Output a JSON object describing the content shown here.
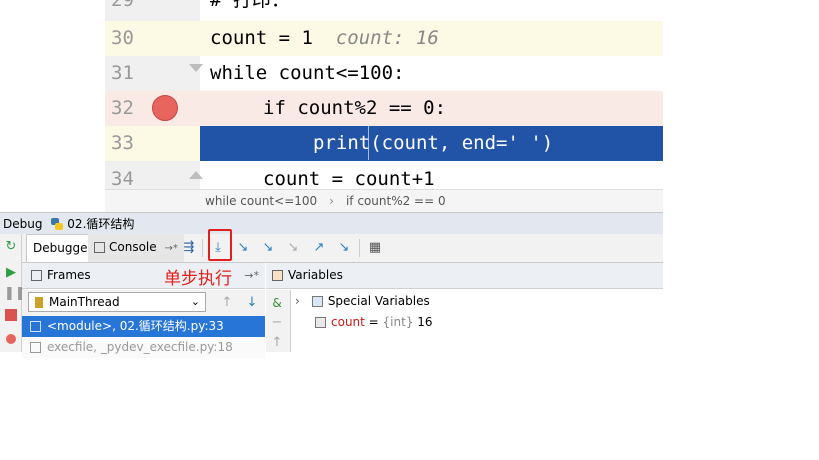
{
  "editor": {
    "lines": [
      {
        "num": "29",
        "code": "# 打印：",
        "partial": true
      },
      {
        "num": "30",
        "code": "count = 1",
        "hint": "count: 16"
      },
      {
        "num": "31",
        "code": "while count<=100:"
      },
      {
        "num": "32",
        "code": "if count%2 == 0:"
      },
      {
        "num": "33",
        "code": "print(count, end=' ')"
      },
      {
        "num": "34",
        "code": "count = count+1"
      }
    ],
    "breadcrumbs": [
      "while count<=100",
      "if count%2 == 0"
    ]
  },
  "debug": {
    "title_prefix": "Debug",
    "config_name": "02.循环结构",
    "tabs": [
      "Debugger",
      "Console"
    ],
    "console_pin": "→*",
    "frames_label": "Frames",
    "frames_pin": "→*",
    "variables_label": "Variables",
    "annotation": "单步执行",
    "thread": "MainThread",
    "frames": [
      {
        "label": "<module>, 02.循环结构.py:33",
        "selected": true
      },
      {
        "label": "execfile, _pydev_execfile.py:18",
        "selected": false
      }
    ],
    "variables": [
      {
        "name": "Special Variables",
        "type": "",
        "value": "",
        "expandable": true
      },
      {
        "name": "count",
        "type": "{int}",
        "value": "16",
        "expandable": false
      }
    ],
    "var_eq": " = "
  },
  "colors": {
    "execution_line": "#2154a7",
    "breakpoint_line": "#faeae6",
    "breakpoint_dot": "#e8655d",
    "annotation_red": "#e0201c",
    "selected_frame": "#2775d7"
  }
}
